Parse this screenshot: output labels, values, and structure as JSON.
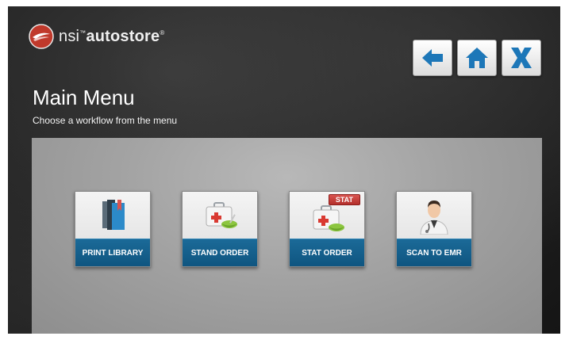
{
  "brand": {
    "prefix": "nsi",
    "tm": "™",
    "name": "autostore",
    "reg": "®"
  },
  "nav": {
    "back_icon": "arrow-left-icon",
    "home_icon": "home-icon",
    "close_icon": "close-x-icon"
  },
  "header": {
    "title": "Main Menu",
    "subtitle": "Choose a workflow from the menu"
  },
  "workflows": [
    {
      "label": "PRINT LIBRARY",
      "icon": "books-icon"
    },
    {
      "label": "STAND ORDER",
      "icon": "medical-kit-icon"
    },
    {
      "label": "STAT ORDER",
      "icon": "medical-kit-stat-icon",
      "badge": "STAT"
    },
    {
      "label": "SCAN TO EMR",
      "icon": "doctor-icon"
    }
  ],
  "colors": {
    "accent_blue": "#1b6a98",
    "nav_icon_blue": "#1d77b8",
    "badge_red": "#c0392b"
  }
}
